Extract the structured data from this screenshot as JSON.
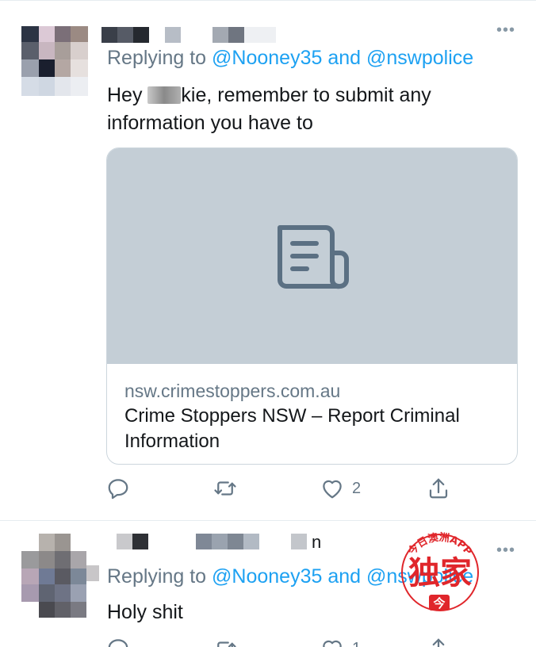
{
  "tweets": [
    {
      "reply_prefix": "Replying to ",
      "reply_handles": "@Nooney35 and @nswpolice",
      "text_before": "Hey ",
      "text_after": "kie, remember to submit any information you have to",
      "card": {
        "domain": "nsw.crimestoppers.com.au",
        "title": "Crime Stoppers NSW – Report Criminal Information",
        "icon": "document-icon"
      },
      "actions": {
        "reply_icon": "reply-icon",
        "retweet_icon": "retweet-icon",
        "like_icon": "heart-icon",
        "like_count": "2",
        "share_icon": "share-icon"
      }
    },
    {
      "reply_prefix": "Replying to ",
      "reply_handles": "@Nooney35 and @nswpolice",
      "name_tail": "n",
      "text": "Holy shit",
      "actions": {
        "like_count": "1"
      }
    }
  ],
  "watermark": {
    "ring_text": "今日澳洲APP",
    "main_text": "独家",
    "badge_text": "今",
    "color": "#e0262b"
  },
  "colors": {
    "link": "#1da1f2",
    "secondary": "#657786",
    "card_media": "#c4ced6"
  }
}
